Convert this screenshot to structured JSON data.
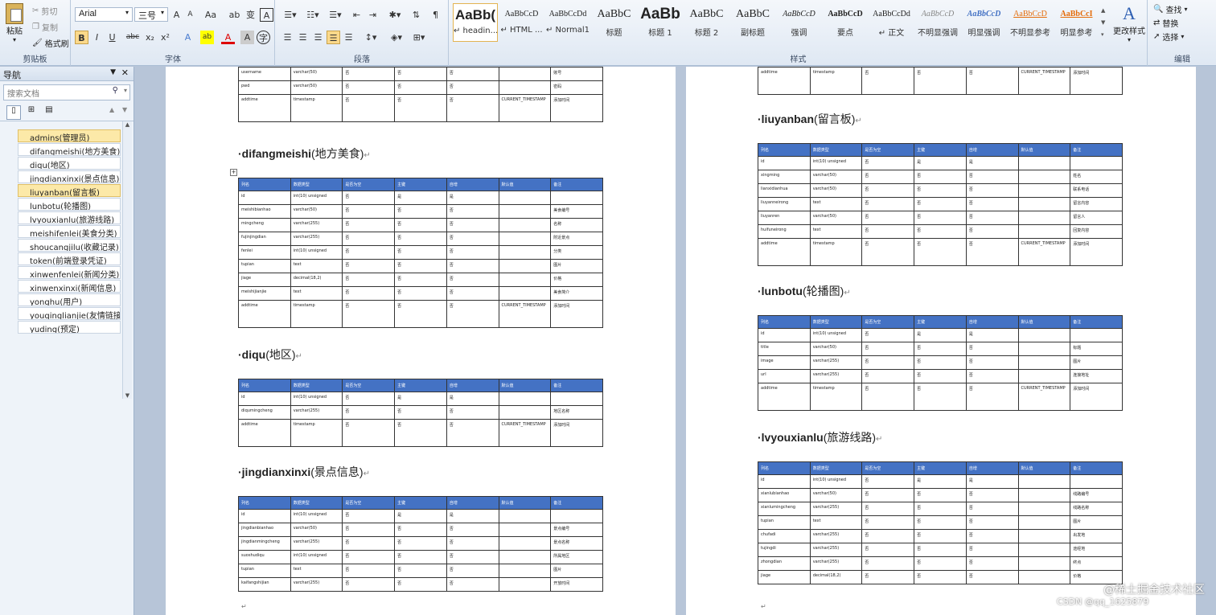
{
  "ribbon": {
    "clipboard": {
      "paste": "粘贴",
      "cut": "剪切",
      "copy": "复制",
      "format_painter": "格式刷",
      "label": "剪贴板"
    },
    "font": {
      "name": "Arial",
      "size": "三号",
      "label": "字体",
      "grow": "A",
      "shrink": "A",
      "case": "Aa",
      "bold": "B",
      "italic": "I",
      "underline": "U",
      "strike": "abc",
      "sub": "x₂",
      "sup": "x²"
    },
    "paragraph": {
      "label": "段落"
    },
    "styles": {
      "label": "样式",
      "items": [
        {
          "preview": "AaBb(",
          "name": "↵ headin..."
        },
        {
          "preview": "AaBbCcD",
          "name": "↵ HTML ..."
        },
        {
          "preview": "AaBbCcDd",
          "name": "↵ Normal1"
        },
        {
          "preview": "AaBbC",
          "name": "标题"
        },
        {
          "preview": "AaBb",
          "name": "标题 1"
        },
        {
          "preview": "AaBbC",
          "name": "标题 2"
        },
        {
          "preview": "AaBbC",
          "name": "副标题"
        },
        {
          "preview": "AaBbCcD",
          "name": "强调"
        },
        {
          "preview": "AaBbCcD",
          "name": "要点"
        },
        {
          "preview": "AaBbCcDd",
          "name": "↵ 正文"
        },
        {
          "preview": "AaBbCcD",
          "name": "不明显强调"
        },
        {
          "preview": "AaBbCcD",
          "name": "明显强调"
        },
        {
          "preview": "AaBbCcD",
          "name": "不明显参考"
        },
        {
          "preview": "AaBbCcI",
          "name": "明显参考"
        }
      ],
      "change_styles": "更改样式"
    },
    "editing": {
      "find": "查找",
      "replace": "替换",
      "select": "选择",
      "label": "编辑"
    }
  },
  "nav": {
    "title": "导航",
    "search_placeholder": "搜索文档",
    "items": [
      "admins(管理员)",
      "difangmeishi(地方美食)",
      "diqu(地区)",
      "jingdianxinxi(景点信息)",
      "liuyanban(留言板)",
      "lunbotu(轮播图)",
      "lvyouxianlu(旅游线路)",
      "meishifenlei(美食分类)",
      "shoucangjilu(收藏记录)",
      "token(前端登录凭证)",
      "xinwenfenlei(新闻分类)",
      "xinwenxinxi(新闻信息)",
      "yonghu(用户)",
      "youqinglianjie(友情链接)",
      "yuding(预定)"
    ]
  },
  "doc": {
    "headers": [
      "列名",
      "数据类型",
      "是否为空",
      "主键",
      "自增",
      "默认值",
      "备注"
    ],
    "left_top_rows": [
      [
        "username",
        "varchar(50)",
        "否",
        "否",
        "否",
        "",
        "账号"
      ],
      [
        "pwd",
        "varchar(50)",
        "否",
        "否",
        "否",
        "",
        "密码"
      ],
      [
        "addtime",
        "timestamp",
        "否",
        "否",
        "否",
        "CURRENT_TIMESTAMP",
        "添加时间"
      ]
    ],
    "right_top_rows": [
      [
        "addtime",
        "timestamp",
        "否",
        "否",
        "否",
        "CURRENT_TIMESTAMP",
        "添加时间"
      ]
    ],
    "sections": [
      {
        "en": "difangmeishi",
        "cn": "(地方美食)",
        "rows": [
          [
            "id",
            "int(10) unsigned",
            "否",
            "是",
            "是",
            "",
            ""
          ],
          [
            "meishibianhao",
            "varchar(50)",
            "否",
            "否",
            "否",
            "",
            "美食编号"
          ],
          [
            "mingcheng",
            "varchar(255)",
            "否",
            "否",
            "否",
            "",
            "名称"
          ],
          [
            "fujinjingdian",
            "varchar(255)",
            "否",
            "否",
            "否",
            "",
            "附近景点"
          ],
          [
            "fenlei",
            "int(10) unsigned",
            "否",
            "否",
            "否",
            "",
            "分类"
          ],
          [
            "tupian",
            "text",
            "否",
            "否",
            "否",
            "",
            "图片"
          ],
          [
            "jiage",
            "decimal(18,2)",
            "否",
            "否",
            "否",
            "",
            "价格"
          ],
          [
            "meishijianjie",
            "text",
            "否",
            "否",
            "否",
            "",
            "美食简介"
          ],
          [
            "addtime",
            "timestamp",
            "否",
            "否",
            "否",
            "CURRENT_TIMESTAMP",
            "添加时间"
          ]
        ]
      },
      {
        "en": "diqu",
        "cn": "(地区)",
        "rows": [
          [
            "id",
            "int(10) unsigned",
            "否",
            "是",
            "是",
            "",
            ""
          ],
          [
            "diqumingcheng",
            "varchar(255)",
            "否",
            "否",
            "否",
            "",
            "地区名称"
          ],
          [
            "addtime",
            "timestamp",
            "否",
            "否",
            "否",
            "CURRENT_TIMESTAMP",
            "添加时间"
          ]
        ]
      },
      {
        "en": "jingdianxinxi",
        "cn": "(景点信息)",
        "rows": [
          [
            "id",
            "int(10) unsigned",
            "否",
            "是",
            "是",
            "",
            ""
          ],
          [
            "jingdianbianhao",
            "varchar(50)",
            "否",
            "否",
            "否",
            "",
            "景点编号"
          ],
          [
            "jingdianmingcheng",
            "varchar(255)",
            "否",
            "否",
            "否",
            "",
            "景点名称"
          ],
          [
            "suoshudiqu",
            "int(10) unsigned",
            "否",
            "否",
            "否",
            "",
            "所属地区"
          ],
          [
            "tupian",
            "text",
            "否",
            "否",
            "否",
            "",
            "图片"
          ],
          [
            "kaifangshijian",
            "varchar(255)",
            "否",
            "否",
            "否",
            "",
            "开放时间"
          ]
        ]
      },
      {
        "en": "liuyanban",
        "cn": "(留言板)",
        "rows": [
          [
            "id",
            "int(10) unsigned",
            "否",
            "是",
            "是",
            "",
            ""
          ],
          [
            "xingming",
            "varchar(50)",
            "否",
            "否",
            "否",
            "",
            "姓名"
          ],
          [
            "lianxidianhua",
            "varchar(50)",
            "否",
            "否",
            "否",
            "",
            "联系电话"
          ],
          [
            "liuyanneirong",
            "text",
            "否",
            "否",
            "否",
            "",
            "留言内容"
          ],
          [
            "liuyanren",
            "varchar(50)",
            "否",
            "否",
            "否",
            "",
            "留言人"
          ],
          [
            "huifuneirong",
            "text",
            "否",
            "否",
            "否",
            "",
            "回复内容"
          ],
          [
            "addtime",
            "timestamp",
            "否",
            "否",
            "否",
            "CURRENT_TIMESTAMP",
            "添加时间"
          ]
        ]
      },
      {
        "en": "lunbotu",
        "cn": "(轮播图)",
        "rows": [
          [
            "id",
            "int(10) unsigned",
            "否",
            "是",
            "是",
            "",
            ""
          ],
          [
            "title",
            "varchar(50)",
            "否",
            "否",
            "否",
            "",
            "标题"
          ],
          [
            "image",
            "varchar(255)",
            "否",
            "否",
            "否",
            "",
            "图片"
          ],
          [
            "url",
            "varchar(255)",
            "否",
            "否",
            "否",
            "",
            "连接地址"
          ],
          [
            "addtime",
            "timestamp",
            "否",
            "否",
            "否",
            "CURRENT_TIMESTAMP",
            "添加时间"
          ]
        ]
      },
      {
        "en": "lvyouxianlu",
        "cn": "(旅游线路)",
        "rows": [
          [
            "id",
            "int(10) unsigned",
            "否",
            "是",
            "是",
            "",
            ""
          ],
          [
            "xianlubianhao",
            "varchar(50)",
            "否",
            "否",
            "否",
            "",
            "线路编号"
          ],
          [
            "xianlumingcheng",
            "varchar(255)",
            "否",
            "否",
            "否",
            "",
            "线路名称"
          ],
          [
            "tupian",
            "text",
            "否",
            "否",
            "否",
            "",
            "图片"
          ],
          [
            "chufadi",
            "varchar(255)",
            "否",
            "否",
            "否",
            "",
            "出发地"
          ],
          [
            "tujingdi",
            "varchar(255)",
            "否",
            "否",
            "否",
            "",
            "途经地"
          ],
          [
            "zhongdian",
            "varchar(255)",
            "否",
            "否",
            "否",
            "",
            "终点"
          ],
          [
            "jiage",
            "decimal(18,2)",
            "否",
            "否",
            "否",
            "",
            "价格"
          ]
        ]
      }
    ]
  },
  "watermark": "@稀土掘金技术社区",
  "watermark2": "CSDN @qq_1625879"
}
